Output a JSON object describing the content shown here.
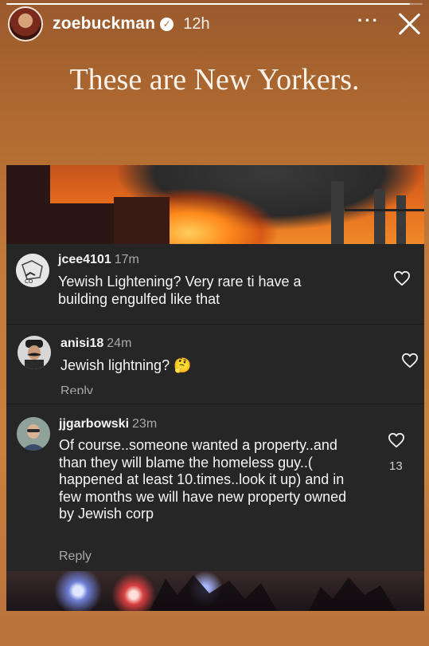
{
  "story": {
    "progress": 0.97,
    "username": "zoebuckman",
    "verified_icon": "verified-badge-icon",
    "time_ago": "12h",
    "more_label": "···",
    "caption": "These are New Yorkers."
  },
  "comments": [
    {
      "username": "jcee4101",
      "time": "17m",
      "text": "Yewish Lightening? Very rare ti have a building engulfed like that",
      "likes": ""
    },
    {
      "username": "anisi18",
      "time": "24m",
      "text": "Jewish lightning?",
      "emoji": "🤔",
      "reply_label": "Reply"
    },
    {
      "username": "jjgarbowski",
      "time": "23m",
      "text": "Of course..someone wanted a property..and than they will blame the homeless guy..( happened at least 10.times..look it up) and in few months we will have new property owned by Jewish corp",
      "likes": "13",
      "reply_label": "Reply"
    }
  ],
  "colors": {
    "panel_bg": "#262626",
    "story_bg": "#c07a3a",
    "muted_text": "#a8a8a8"
  }
}
